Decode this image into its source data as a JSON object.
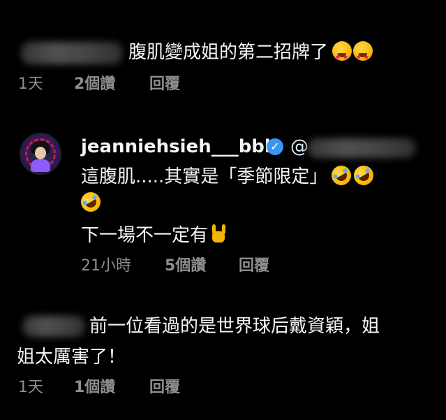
{
  "comments": [
    {
      "text": "腹肌變成姐的第二招牌了",
      "emojis": [
        "star-struck-emoji",
        "star-struck-emoji"
      ],
      "time": "1天",
      "likes": "2個讚",
      "reply": "回覆"
    },
    {
      "username": "jeanniehsieh___bbb",
      "mention_prefix": "@",
      "lines": [
        "這腹肌.....其實是「季節限定」",
        "",
        "下一場不一定有"
      ],
      "emojis_line1": [
        "rofl-emoji",
        "rofl-emoji"
      ],
      "emojis_line2": [
        "rofl-emoji"
      ],
      "emojis_line3": [
        "love-you-gesture-emoji"
      ],
      "time": "21小時",
      "likes": "5個讚",
      "reply": "回覆"
    },
    {
      "text_line1": "前一位看過的是世界球后戴資穎，姐",
      "text_line2": "姐太厲害了！",
      "time": "1天",
      "likes": "1個讚",
      "reply": "回覆"
    }
  ],
  "colors": {
    "background": "#000000",
    "text": "#f5f5f5",
    "meta": "#8e8e8e",
    "verified": "#3897f0"
  }
}
